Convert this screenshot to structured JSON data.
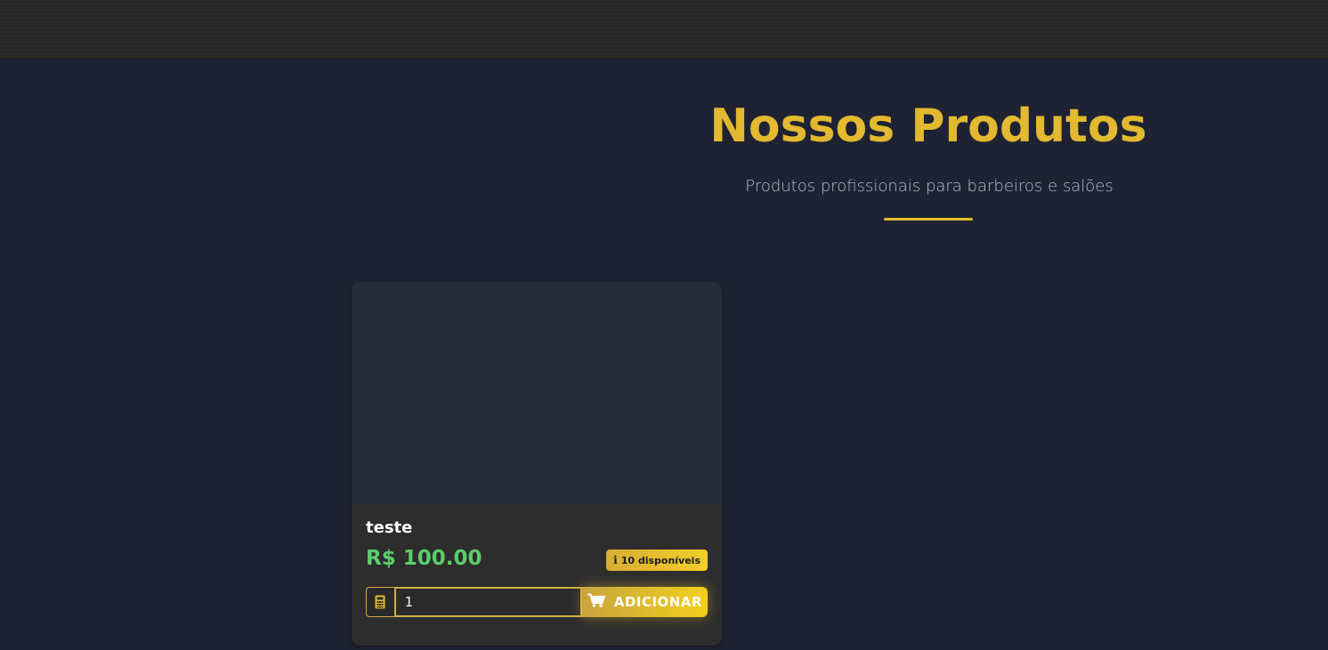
{
  "header": {},
  "hero": {
    "title": "Nossos Produtos",
    "subtitle": "Produtos profissionais para barbeiros e salões"
  },
  "products": [
    {
      "name": "teste",
      "price": "R$ 100.00",
      "stock": "10 disponíveis",
      "quantity": "1",
      "add_label": "ADICIONAR"
    }
  ],
  "icons": {
    "info": "info-icon",
    "calculator": "calculator-icon",
    "cart": "cart-icon"
  },
  "colors": {
    "accent": "#e2b930",
    "price": "#5ccd6a",
    "background": "#1e2233",
    "card": "#2d2d2d"
  }
}
